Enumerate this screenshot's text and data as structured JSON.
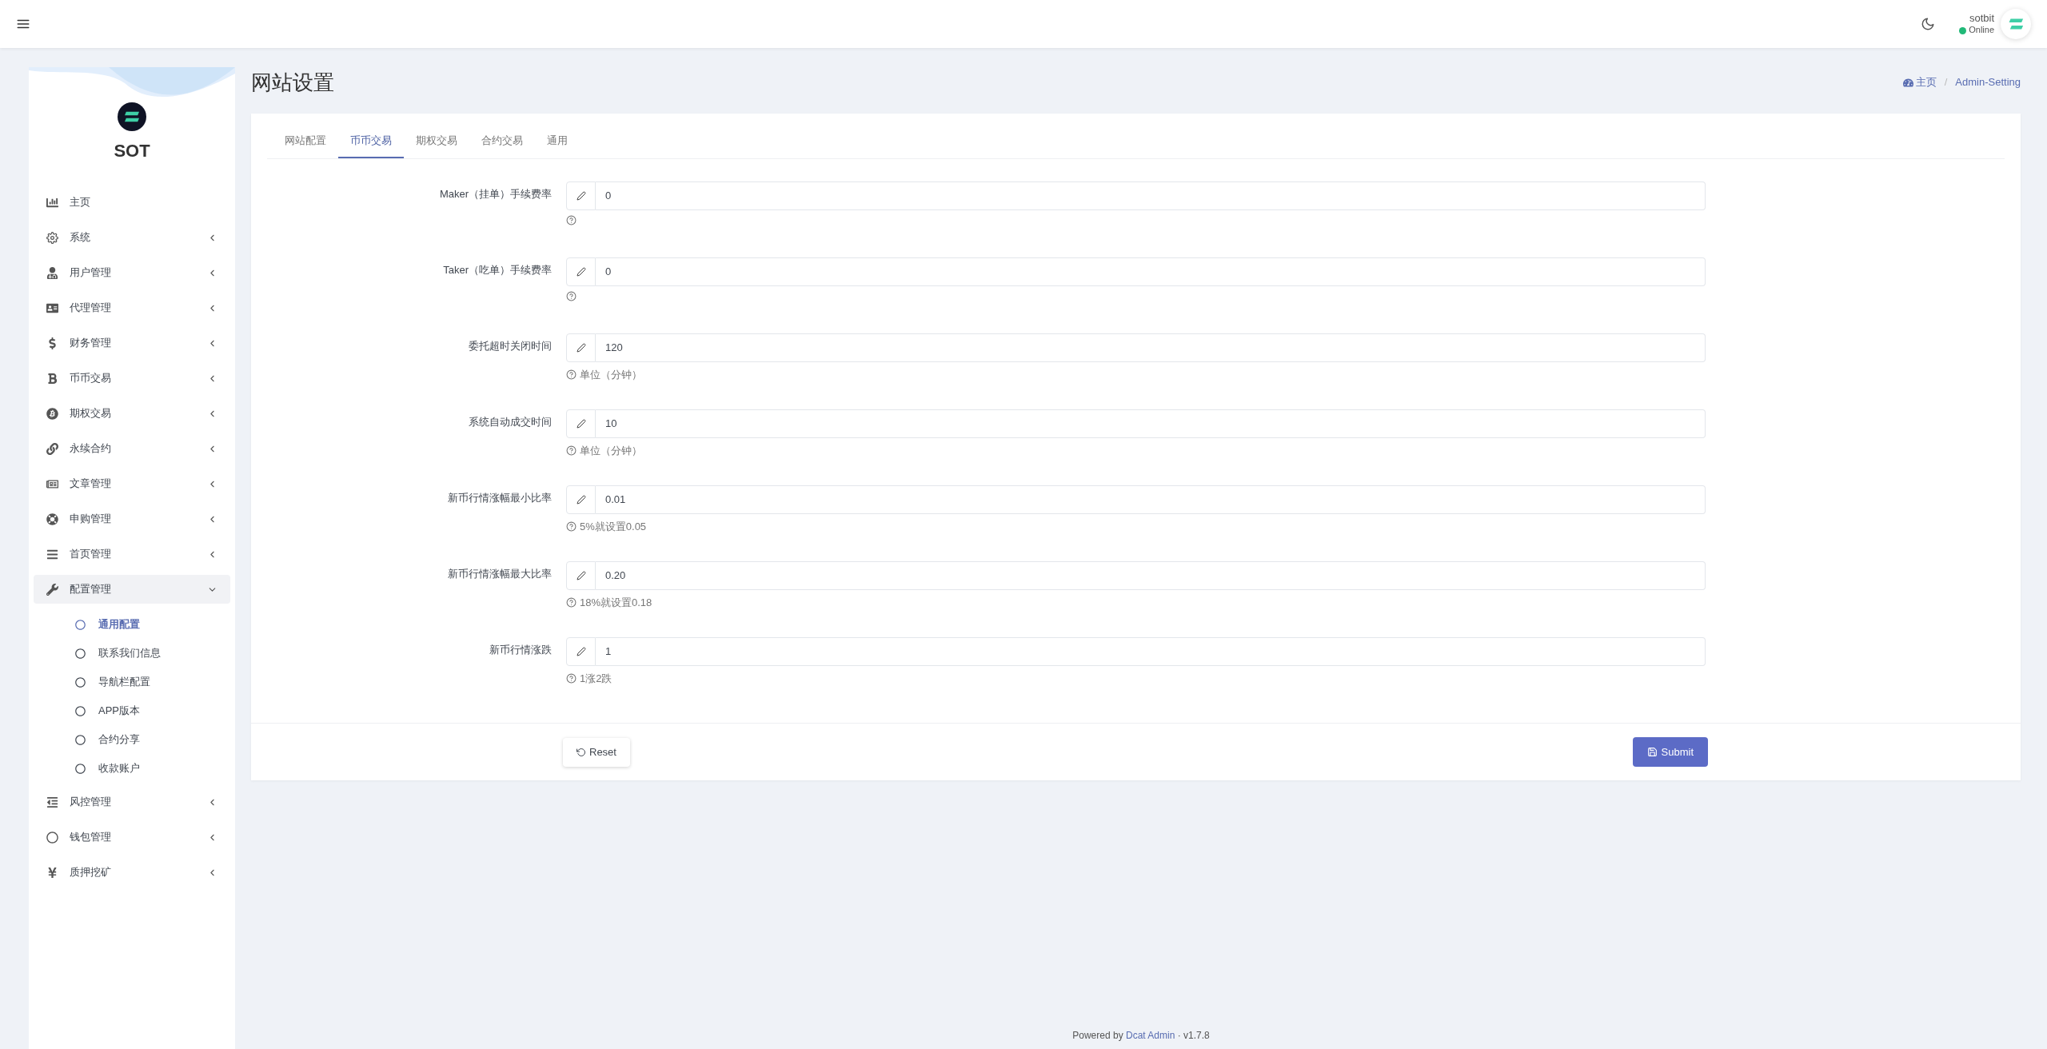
{
  "header": {
    "user_name": "sotbit",
    "status": "Online",
    "online": true
  },
  "sidebar": {
    "brand": "SOT",
    "items": [
      {
        "label": "主页",
        "kind": "link"
      },
      {
        "label": "系统",
        "kind": "group",
        "expanded": false
      },
      {
        "label": "用户管理",
        "kind": "group",
        "expanded": false
      },
      {
        "label": "代理管理",
        "kind": "group",
        "expanded": false
      },
      {
        "label": "财务管理",
        "kind": "group",
        "expanded": false
      },
      {
        "label": "币币交易",
        "kind": "group",
        "expanded": false
      },
      {
        "label": "期权交易",
        "kind": "group",
        "expanded": false
      },
      {
        "label": "永续合约",
        "kind": "group",
        "expanded": false
      },
      {
        "label": "文章管理",
        "kind": "group",
        "expanded": false
      },
      {
        "label": "申购管理",
        "kind": "group",
        "expanded": false
      },
      {
        "label": "首页管理",
        "kind": "group",
        "expanded": false
      },
      {
        "label": "配置管理",
        "kind": "group",
        "expanded": true,
        "children": [
          {
            "label": "通用配置",
            "selected": true
          },
          {
            "label": "联系我们信息",
            "selected": false
          },
          {
            "label": "导航栏配置",
            "selected": false
          },
          {
            "label": "APP版本",
            "selected": false
          },
          {
            "label": "合约分享",
            "selected": false
          },
          {
            "label": "收款账户",
            "selected": false
          }
        ]
      },
      {
        "label": "风控管理",
        "kind": "group",
        "expanded": false
      },
      {
        "label": "钱包管理",
        "kind": "group",
        "expanded": false
      },
      {
        "label": "质押挖矿",
        "kind": "group",
        "expanded": false
      }
    ]
  },
  "page": {
    "title": "网站设置",
    "breadcrumb": [
      {
        "label": "主页"
      },
      {
        "label": "Admin-Setting"
      }
    ],
    "breadcrumb_separator": "/"
  },
  "tabs": [
    {
      "label": "网站配置",
      "selected": false
    },
    {
      "label": "币币交易",
      "selected": true
    },
    {
      "label": "期权交易",
      "selected": false
    },
    {
      "label": "合约交易",
      "selected": false
    },
    {
      "label": "通用",
      "selected": false
    }
  ],
  "fields": [
    {
      "label": "Maker（挂单）手续费率",
      "value": "0"
    },
    {
      "label": "Taker（吃单）手续费率",
      "value": "0"
    },
    {
      "label": "委托超时关闭时间",
      "value": "120",
      "help": "单位（分钟）"
    },
    {
      "label": "系统自动成交时间",
      "value": "10",
      "help": "单位（分钟）"
    },
    {
      "label": "新币行情涨幅最小比率",
      "value": "0.01",
      "help": "5%就设置0.05"
    },
    {
      "label": "新币行情涨幅最大比率",
      "value": "0.20",
      "help": "18%就设置0.18"
    },
    {
      "label": "新币行情涨跌",
      "value": "1",
      "help": "1涨2跌"
    }
  ],
  "buttons": {
    "reset": "Reset",
    "submit": "Submit"
  },
  "footer": {
    "prefix": "Powered by",
    "link": "Dcat Admin",
    "separator": "·",
    "version": "v1.7.8"
  }
}
